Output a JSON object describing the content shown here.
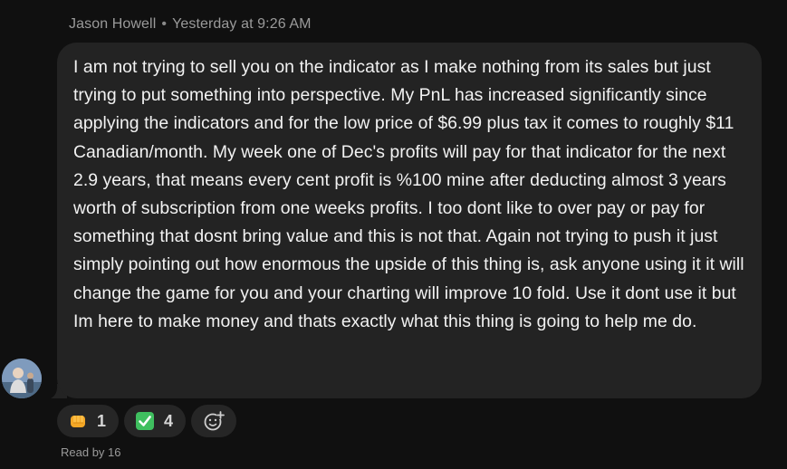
{
  "message": {
    "sender": "Jason Howell",
    "timestamp": "Yesterday at 9:26 AM",
    "text": "I am not trying to sell you on the indicator as I make nothing from its sales but just trying to put something into perspective. My PnL has increased significantly since applying the indicators and for the low price of $6.99 plus tax it comes to roughly $11 Canadian/month. My week one of Dec's profits will pay for that indicator for the next 2.9 years, that means every cent profit is %100 mine after deducting almost 3 years worth of subscription from one weeks profits. I too dont like to over pay or pay for something that dosnt bring value and this is not that. Again not trying to push it just simply pointing out how enormous the upside of this thing is, ask anyone using it it will change the game for you and your charting will improve 10 fold. Use it dont use it but Im here to make money and thats exactly what this thing is going to help me do."
  },
  "reactions": [
    {
      "icon": "fist-bump-emoji",
      "count": "1"
    },
    {
      "icon": "check-mark-emoji",
      "count": "4"
    }
  ],
  "read_receipt": "Read by 16",
  "colors": {
    "background": "#101010",
    "bubble": "#232323",
    "reaction_pill": "#262626",
    "check_green": "#3fbf5f",
    "fist_orange": "#f4a726"
  }
}
